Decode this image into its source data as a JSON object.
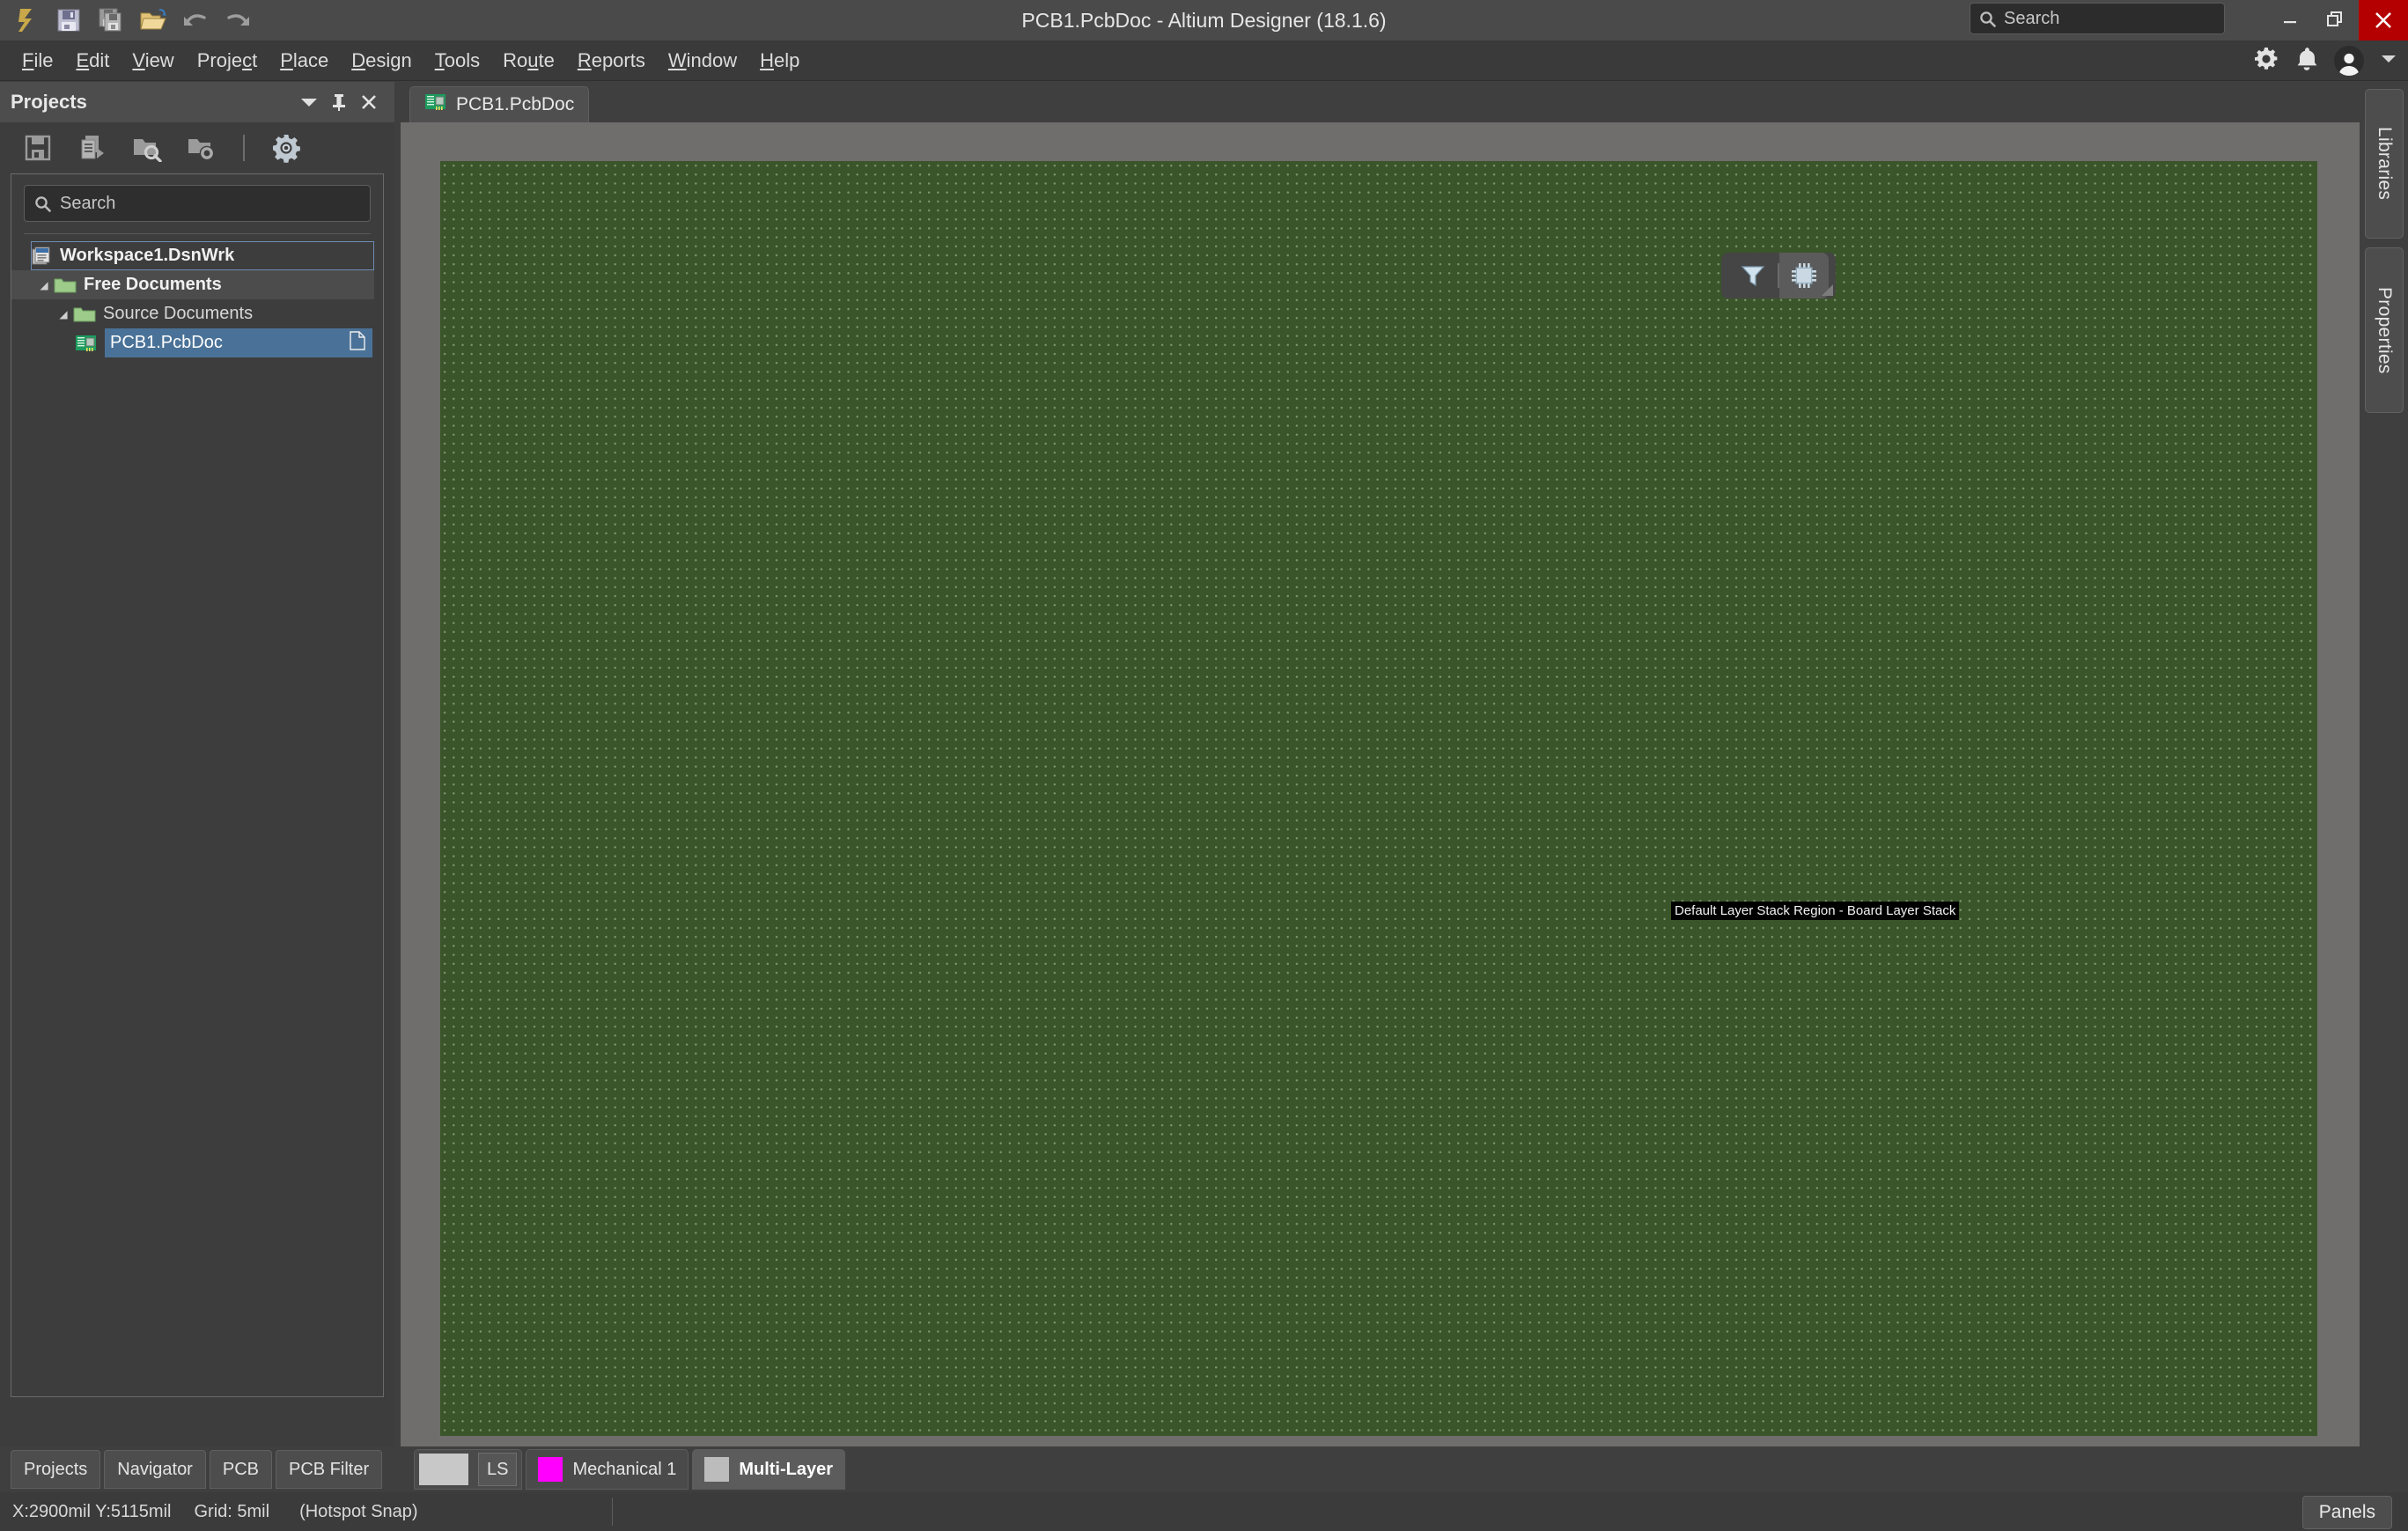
{
  "window": {
    "title": "PCB1.PcbDoc - Altium Designer (18.1.6)",
    "search_placeholder": "Search",
    "minimize_label": "—",
    "restore_label": "❐",
    "close_label": "✕"
  },
  "quick_access": [
    {
      "name": "altium-logo-icon",
      "label": "Altium"
    },
    {
      "name": "save-icon",
      "label": "Save"
    },
    {
      "name": "save-all-icon",
      "label": "Save All"
    },
    {
      "name": "open-folder-icon",
      "label": "Open"
    },
    {
      "name": "undo-icon",
      "label": "Undo"
    },
    {
      "name": "redo-icon",
      "label": "Redo"
    }
  ],
  "menu": [
    {
      "pre": "",
      "mn": "F",
      "post": "ile"
    },
    {
      "pre": "",
      "mn": "E",
      "post": "dit"
    },
    {
      "pre": "",
      "mn": "V",
      "post": "iew"
    },
    {
      "pre": "Proje",
      "mn": "c",
      "post": "t"
    },
    {
      "pre": "",
      "mn": "P",
      "post": "lace"
    },
    {
      "pre": "",
      "mn": "D",
      "post": "esign"
    },
    {
      "pre": "",
      "mn": "T",
      "post": "ools"
    },
    {
      "pre": "Ro",
      "mn": "u",
      "post": "te"
    },
    {
      "pre": "",
      "mn": "R",
      "post": "eports"
    },
    {
      "pre": "",
      "mn": "W",
      "post": "indow"
    },
    {
      "pre": "",
      "mn": "H",
      "post": "elp"
    }
  ],
  "menubar_right": [
    {
      "name": "gear-icon"
    },
    {
      "name": "bell-icon"
    },
    {
      "name": "avatar"
    },
    {
      "name": "chevron-down-icon"
    }
  ],
  "projects_panel": {
    "title": "Projects",
    "header_buttons": [
      {
        "name": "panel-dropdown-icon",
        "glyph": "▼"
      },
      {
        "name": "panel-pin-icon",
        "glyph": "⚑"
      },
      {
        "name": "panel-close-icon",
        "glyph": "✕"
      }
    ],
    "toolbar": [
      {
        "name": "save-project-icon"
      },
      {
        "name": "copy-documents-icon"
      },
      {
        "name": "open-project-search-icon"
      },
      {
        "name": "project-options-icon"
      },
      {
        "name": "panel-settings-gear-icon"
      }
    ],
    "search_placeholder": "Search",
    "tree": [
      {
        "label": "Workspace1.DsnWrk",
        "icon": "workspace-icon",
        "bold": true,
        "level": 0,
        "selected_outline": true,
        "twisty": ""
      },
      {
        "label": "Free Documents",
        "icon": "folder-icon",
        "bold": true,
        "level": 1,
        "twisty": "◢"
      },
      {
        "label": "Source Documents",
        "icon": "folder-icon",
        "bold": false,
        "level": 2,
        "twisty": "◢"
      },
      {
        "label": "PCB1.PcbDoc",
        "icon": "pcb-doc-icon",
        "bold": false,
        "level": 3,
        "selected": true,
        "twisty": "",
        "trailing_icon": "document-icon"
      }
    ],
    "bottom_tabs": [
      "Projects",
      "Navigator",
      "PCB",
      "PCB Filter"
    ]
  },
  "document_tabs": [
    {
      "label": "PCB1.PcbDoc",
      "icon": "pcb-doc-icon",
      "active": true
    }
  ],
  "editor": {
    "floating_toolbar": [
      {
        "name": "filter-funnel-icon",
        "active": false
      },
      {
        "name": "ic-chip-icon",
        "active": true
      }
    ],
    "board_label": "Default Layer Stack Region - Board Layer Stack",
    "board_color": "#3a5529",
    "grid_dot_color": "#7d9170",
    "canvas_background": "#706d6d"
  },
  "right_dock_tabs": [
    {
      "label": "Libraries"
    },
    {
      "label": "Properties"
    }
  ],
  "layer_tabs": [
    {
      "label": "LS",
      "swatch": "#c8c8c8",
      "type": "ls",
      "active": false
    },
    {
      "label": "Mechanical 1",
      "swatch": "#ff00ff",
      "type": "normal",
      "active": false
    },
    {
      "label": "Multi-Layer",
      "swatch": "#bcbcbc",
      "type": "normal",
      "active": true
    }
  ],
  "status_bar": {
    "coords": "X:2900mil Y:5115mil",
    "grid": "Grid: 5mil",
    "snap": "(Hotspot Snap)",
    "panels_label": "Panels"
  }
}
